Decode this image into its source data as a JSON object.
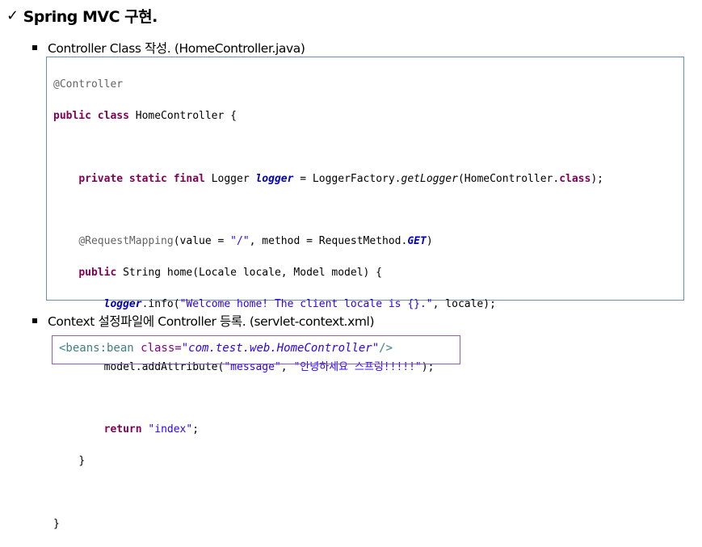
{
  "heading": {
    "check": "✓",
    "title": "Spring MVC 구현."
  },
  "bullets": [
    {
      "text": "Controller Class 작성. (HomeController.java)"
    },
    {
      "text": "Context 설정파일에 Controller 등록. (servlet-context.xml)"
    }
  ],
  "code": {
    "l1_ann": "@Controller",
    "l2_kw": "public class",
    "l2_rest": " HomeController {",
    "l4_kw": "private static final",
    "l4_a": " Logger ",
    "l4_field": "logger",
    "l4_b": " = LoggerFactory.",
    "l4_method": "getLogger",
    "l4_c": "(HomeController.",
    "l4_kw2": "class",
    "l4_d": ");",
    "l6_ann": "@RequestMapping",
    "l6_a": "(value = ",
    "l6_str": "\"/\"",
    "l6_b": ", method = RequestMethod.",
    "l6_const": "GET",
    "l6_c": ")",
    "l7_kw": "public",
    "l7_rest": " String home(Locale locale, Model model) {",
    "l8_field": "logger",
    "l8_a": ".info(",
    "l8_str": "\"Welcome home! The client locale is {}.\"",
    "l8_b": ", locale);",
    "l10_a": "model.addAttribute(",
    "l10_str1": "\"message\"",
    "l10_b": ", ",
    "l10_str2": "\"안녕하세요 스프링!!!!!\"",
    "l10_c": ");",
    "l12_kw": "return",
    "l12_sp": " ",
    "l12_str": "\"index\"",
    "l12_end": ";",
    "l13": "}",
    "l15": "}"
  },
  "xml": {
    "open": "<beans:bean",
    "attr": " class=",
    "value": "\"com.test.web.HomeController\"",
    "close": "/>"
  },
  "colors": {
    "code_border": "#6b8fb3",
    "xml_border": "#8e5fb0",
    "keyword": "#7f0055",
    "string": "#2a00ff",
    "field": "#0000c0",
    "annotation": "#646464"
  }
}
